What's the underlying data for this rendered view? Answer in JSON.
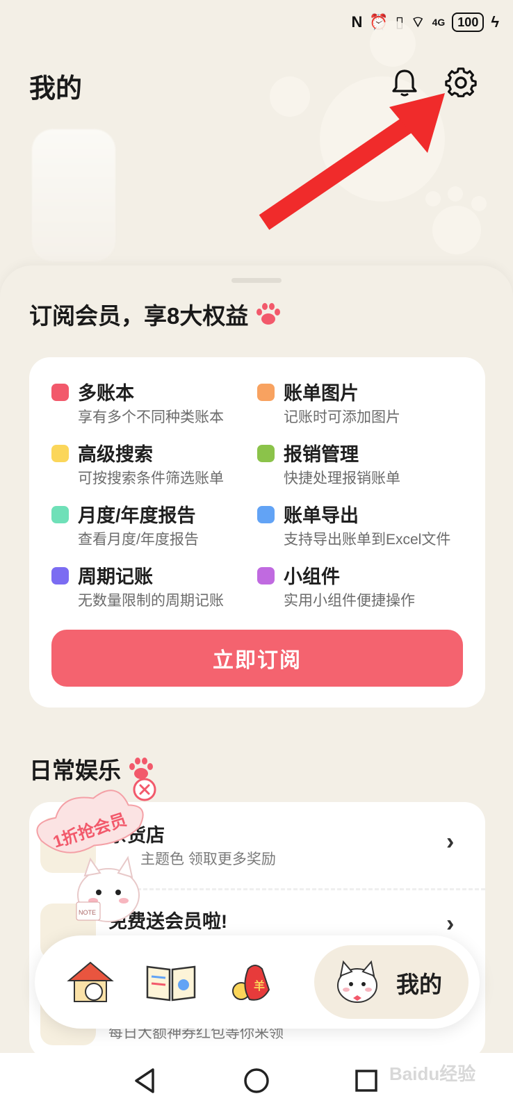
{
  "status_bar": {
    "battery": "100",
    "network": "4G"
  },
  "header": {
    "title": "我的"
  },
  "membership": {
    "title": "订阅会员，享8大权益",
    "features": [
      {
        "name": "多账本",
        "desc": "享有多个不同种类账本",
        "color": "#f2596b"
      },
      {
        "name": "账单图片",
        "desc": "记账时可添加图片",
        "color": "#f8a260"
      },
      {
        "name": "高级搜索",
        "desc": "可按搜索条件筛选账单",
        "color": "#fbd65a"
      },
      {
        "name": "报销管理",
        "desc": "快捷处理报销账单",
        "color": "#8bc34a"
      },
      {
        "name": "月度/年度报告",
        "desc": "查看月度/年度报告",
        "color": "#6fe0b8"
      },
      {
        "name": "账单导出",
        "desc": "支持导出账单到Excel文件",
        "color": "#62a3f5"
      },
      {
        "name": "周期记账",
        "desc": "无数量限制的周期记账",
        "color": "#7b6cf2"
      },
      {
        "name": "小组件",
        "desc": "实用小组件便捷操作",
        "color": "#c06ae0"
      }
    ],
    "subscribe_label": "立即订阅"
  },
  "entertainment": {
    "title": "日常娱乐",
    "items": [
      {
        "title": "杂货店",
        "sub": "主题色 领取更多奖励"
      },
      {
        "title": "免费送会员啦!",
        "sub": ""
      },
      {
        "title": "",
        "sub": "每日大额神券红包等你来领"
      }
    ]
  },
  "promo": {
    "label": "1折抢会员",
    "note": "NOTE"
  },
  "tabbar": {
    "active_label": "我的"
  },
  "watermark": "Baidu经验"
}
